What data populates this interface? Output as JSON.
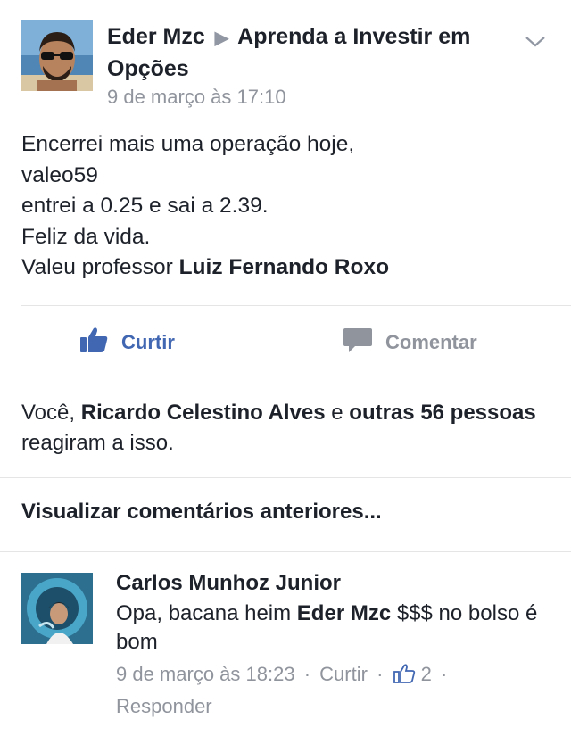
{
  "post": {
    "author": "Eder Mzc",
    "separator": "▶",
    "group": "Aprenda a Investir em Opções",
    "timestamp": "9 de março às 17:10",
    "body": {
      "line1": "Encerrei mais uma operação hoje,",
      "line2": "valeo59",
      "line3": "entrei a 0.25 e sai a 2.39.",
      "line4": "Feliz da vida.",
      "line5_prefix": "Valeu professor ",
      "line5_tag": "Luiz Fernando Roxo"
    }
  },
  "actions": {
    "like_label": "Curtir",
    "comment_label": "Comentar"
  },
  "reactions": {
    "you": "Você",
    "comma": ", ",
    "person": "Ricardo Celestino Alves",
    "and": " e ",
    "others": "outras 56 pessoas",
    "suffix": " reagiram a isso."
  },
  "prev_comments_label": "Visualizar comentários anteriores...",
  "comment": {
    "author": "Carlos Munhoz Junior",
    "text_prefix": "Opa, bacana heim ",
    "text_tag": "Eder Mzc",
    "text_suffix": " $$$ no bolso é bom",
    "timestamp": "9 de março às 18:23",
    "like_label": "Curtir",
    "like_count": "2",
    "reply_label": "Responder",
    "dot": "·"
  },
  "colors": {
    "text": "#1d2129",
    "meta": "#90949c",
    "link_blue": "#4267b2",
    "divider": "#e5e5e5"
  },
  "icons": [
    "chevron-down-icon",
    "thumbs-up-icon",
    "speech-bubble-icon",
    "thumbs-up-outline-icon"
  ]
}
